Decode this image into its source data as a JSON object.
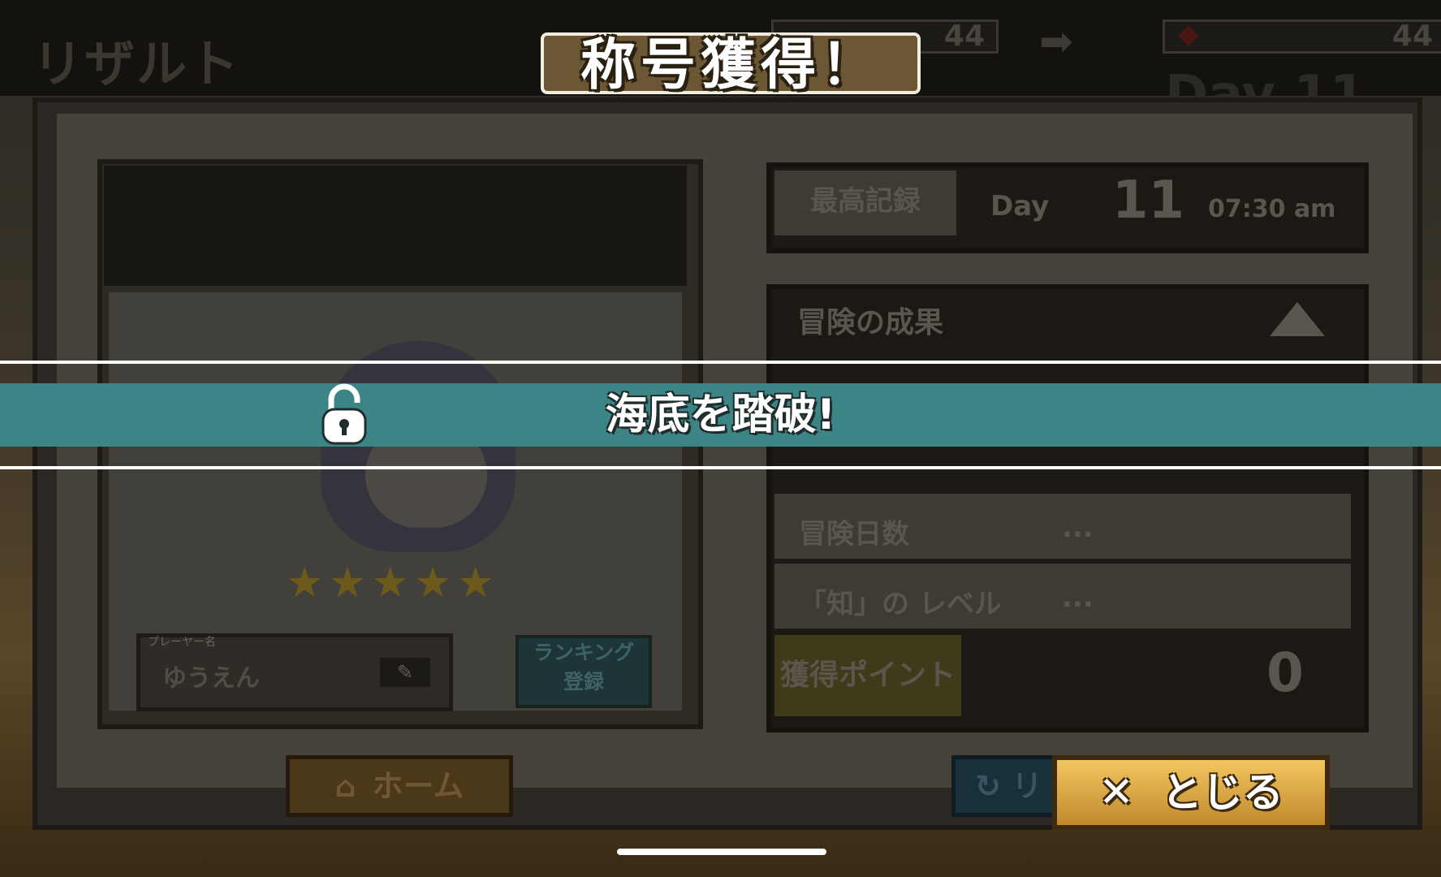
{
  "header": {
    "result_label": "リザルト",
    "count_before": "44",
    "count_after": "44",
    "day_ghost": "Day 11"
  },
  "title_banner": "称号獲得！",
  "unlock_message": "海底を踏破!",
  "player": {
    "name_caption": "プレーヤー名",
    "name": "ゆうえん",
    "rank_button": "ランキング\n登録",
    "stars": 5
  },
  "best_record": {
    "label": "最高記録",
    "day_label": "Day",
    "day": "11",
    "time": "07:30 am"
  },
  "adventure": {
    "title": "冒険の成果",
    "rows": [
      {
        "label": "冒険日数",
        "value": "..."
      },
      {
        "label": "「知」の レベル",
        "value": "..."
      }
    ],
    "points_label": "獲得ポイント",
    "points_value": "0"
  },
  "buttons": {
    "home": "ホーム",
    "retry": "リ",
    "close": "とじる"
  },
  "colors": {
    "unlock_band": "#3b8586",
    "close_button": "#e0a845",
    "title_banner": "#6b5734"
  }
}
